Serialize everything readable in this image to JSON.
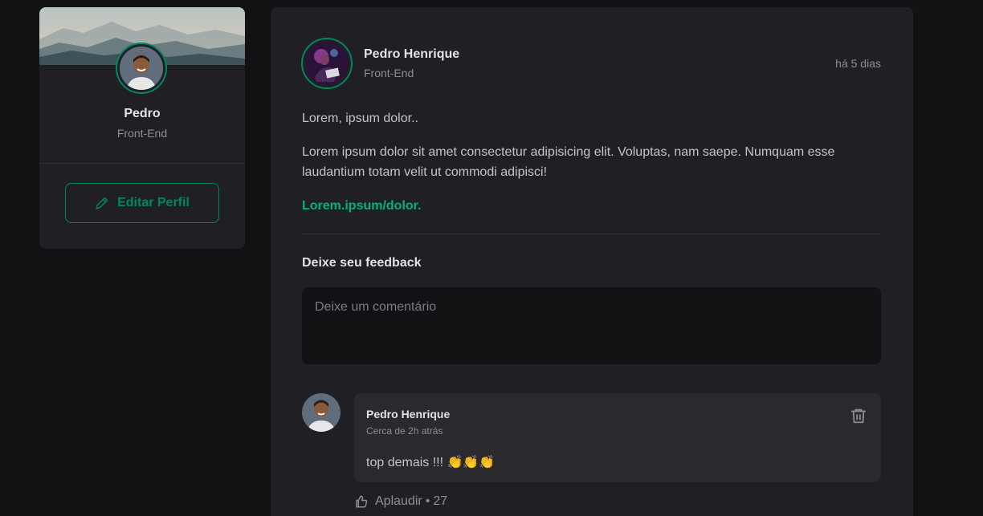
{
  "sidebar": {
    "name": "Pedro",
    "role": "Front-End",
    "edit_label": "Editar Perfil"
  },
  "post": {
    "author_name": "Pedro Henrique",
    "author_role": "Front-End",
    "time": "há 5 dias",
    "paragraphs": [
      "Lorem, ipsum dolor..",
      "Lorem ipsum dolor sit amet consectetur adipisicing elit. Voluptas, nam saepe. Numquam esse laudantium totam velit ut commodi adipisci!"
    ],
    "link": "Lorem.ipsum/dolor.",
    "feedback_title": "Deixe seu feedback",
    "comment_placeholder": "Deixe um comentário"
  },
  "comment": {
    "author": "Pedro Henrique",
    "time": "Cerca de 2h atrás",
    "text": "top demais !!! 👏👏👏",
    "applaud_label": "Aplaudir",
    "applaud_separator": "•",
    "applaud_count": "27"
  },
  "icons": {
    "edit": "pencil-icon",
    "delete": "trash-icon",
    "applaud": "thumbs-up-icon"
  },
  "colors": {
    "accent": "#00875f",
    "link": "#00b37e",
    "background": "#121214",
    "card": "#202024"
  }
}
